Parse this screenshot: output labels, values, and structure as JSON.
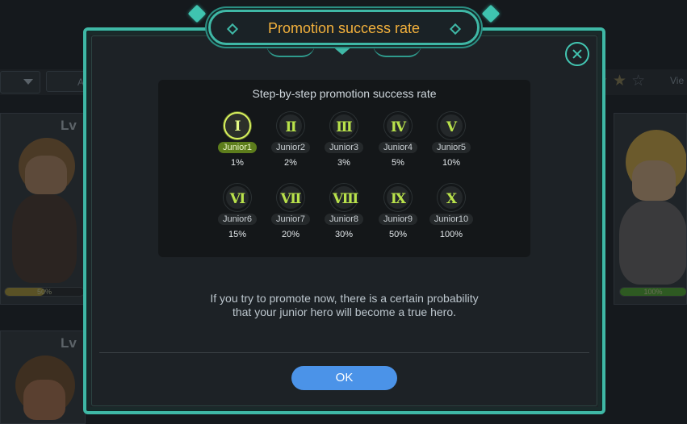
{
  "background": {
    "filter_field_text": "A",
    "view_label": "Vie",
    "rating_stars": 2,
    "cards": [
      {
        "level_label": "Lv",
        "progress_text": "50%",
        "progress_value": 0.5
      },
      {
        "level_label": "Lv",
        "progress_text": "100%",
        "progress_value": 1.0
      },
      {
        "level_label": "Lv"
      }
    ]
  },
  "dialog": {
    "title": "Promotion success rate",
    "panel_title": "Step-by-step promotion success rate",
    "grades": [
      {
        "numeral": "Ⅰ",
        "label": "Junior1",
        "rate": "1%",
        "active": true
      },
      {
        "numeral": "Ⅱ",
        "label": "Junior2",
        "rate": "2%",
        "active": false
      },
      {
        "numeral": "Ⅲ",
        "label": "Junior3",
        "rate": "3%",
        "active": false
      },
      {
        "numeral": "Ⅳ",
        "label": "Junior4",
        "rate": "5%",
        "active": false
      },
      {
        "numeral": "Ⅴ",
        "label": "Junior5",
        "rate": "10%",
        "active": false
      },
      {
        "numeral": "Ⅵ",
        "label": "Junior6",
        "rate": "15%",
        "active": false
      },
      {
        "numeral": "Ⅶ",
        "label": "Junior7",
        "rate": "20%",
        "active": false
      },
      {
        "numeral": "Ⅷ",
        "label": "Junior8",
        "rate": "30%",
        "active": false
      },
      {
        "numeral": "Ⅸ",
        "label": "Junior9",
        "rate": "50%",
        "active": false
      },
      {
        "numeral": "Ⅹ",
        "label": "Junior10",
        "rate": "100%",
        "active": false
      }
    ],
    "description_line1": "If you try to promote now, there is a certain probability",
    "description_line2": "that your junior hero will become a true hero.",
    "ok_label": "OK"
  },
  "colors": {
    "accent_teal": "#3fb8a6",
    "title_gold": "#f3b13c",
    "numeral_green": "#b9e24b",
    "active_pill": "#5d7d1c",
    "ok_blue": "#4b93e8"
  }
}
